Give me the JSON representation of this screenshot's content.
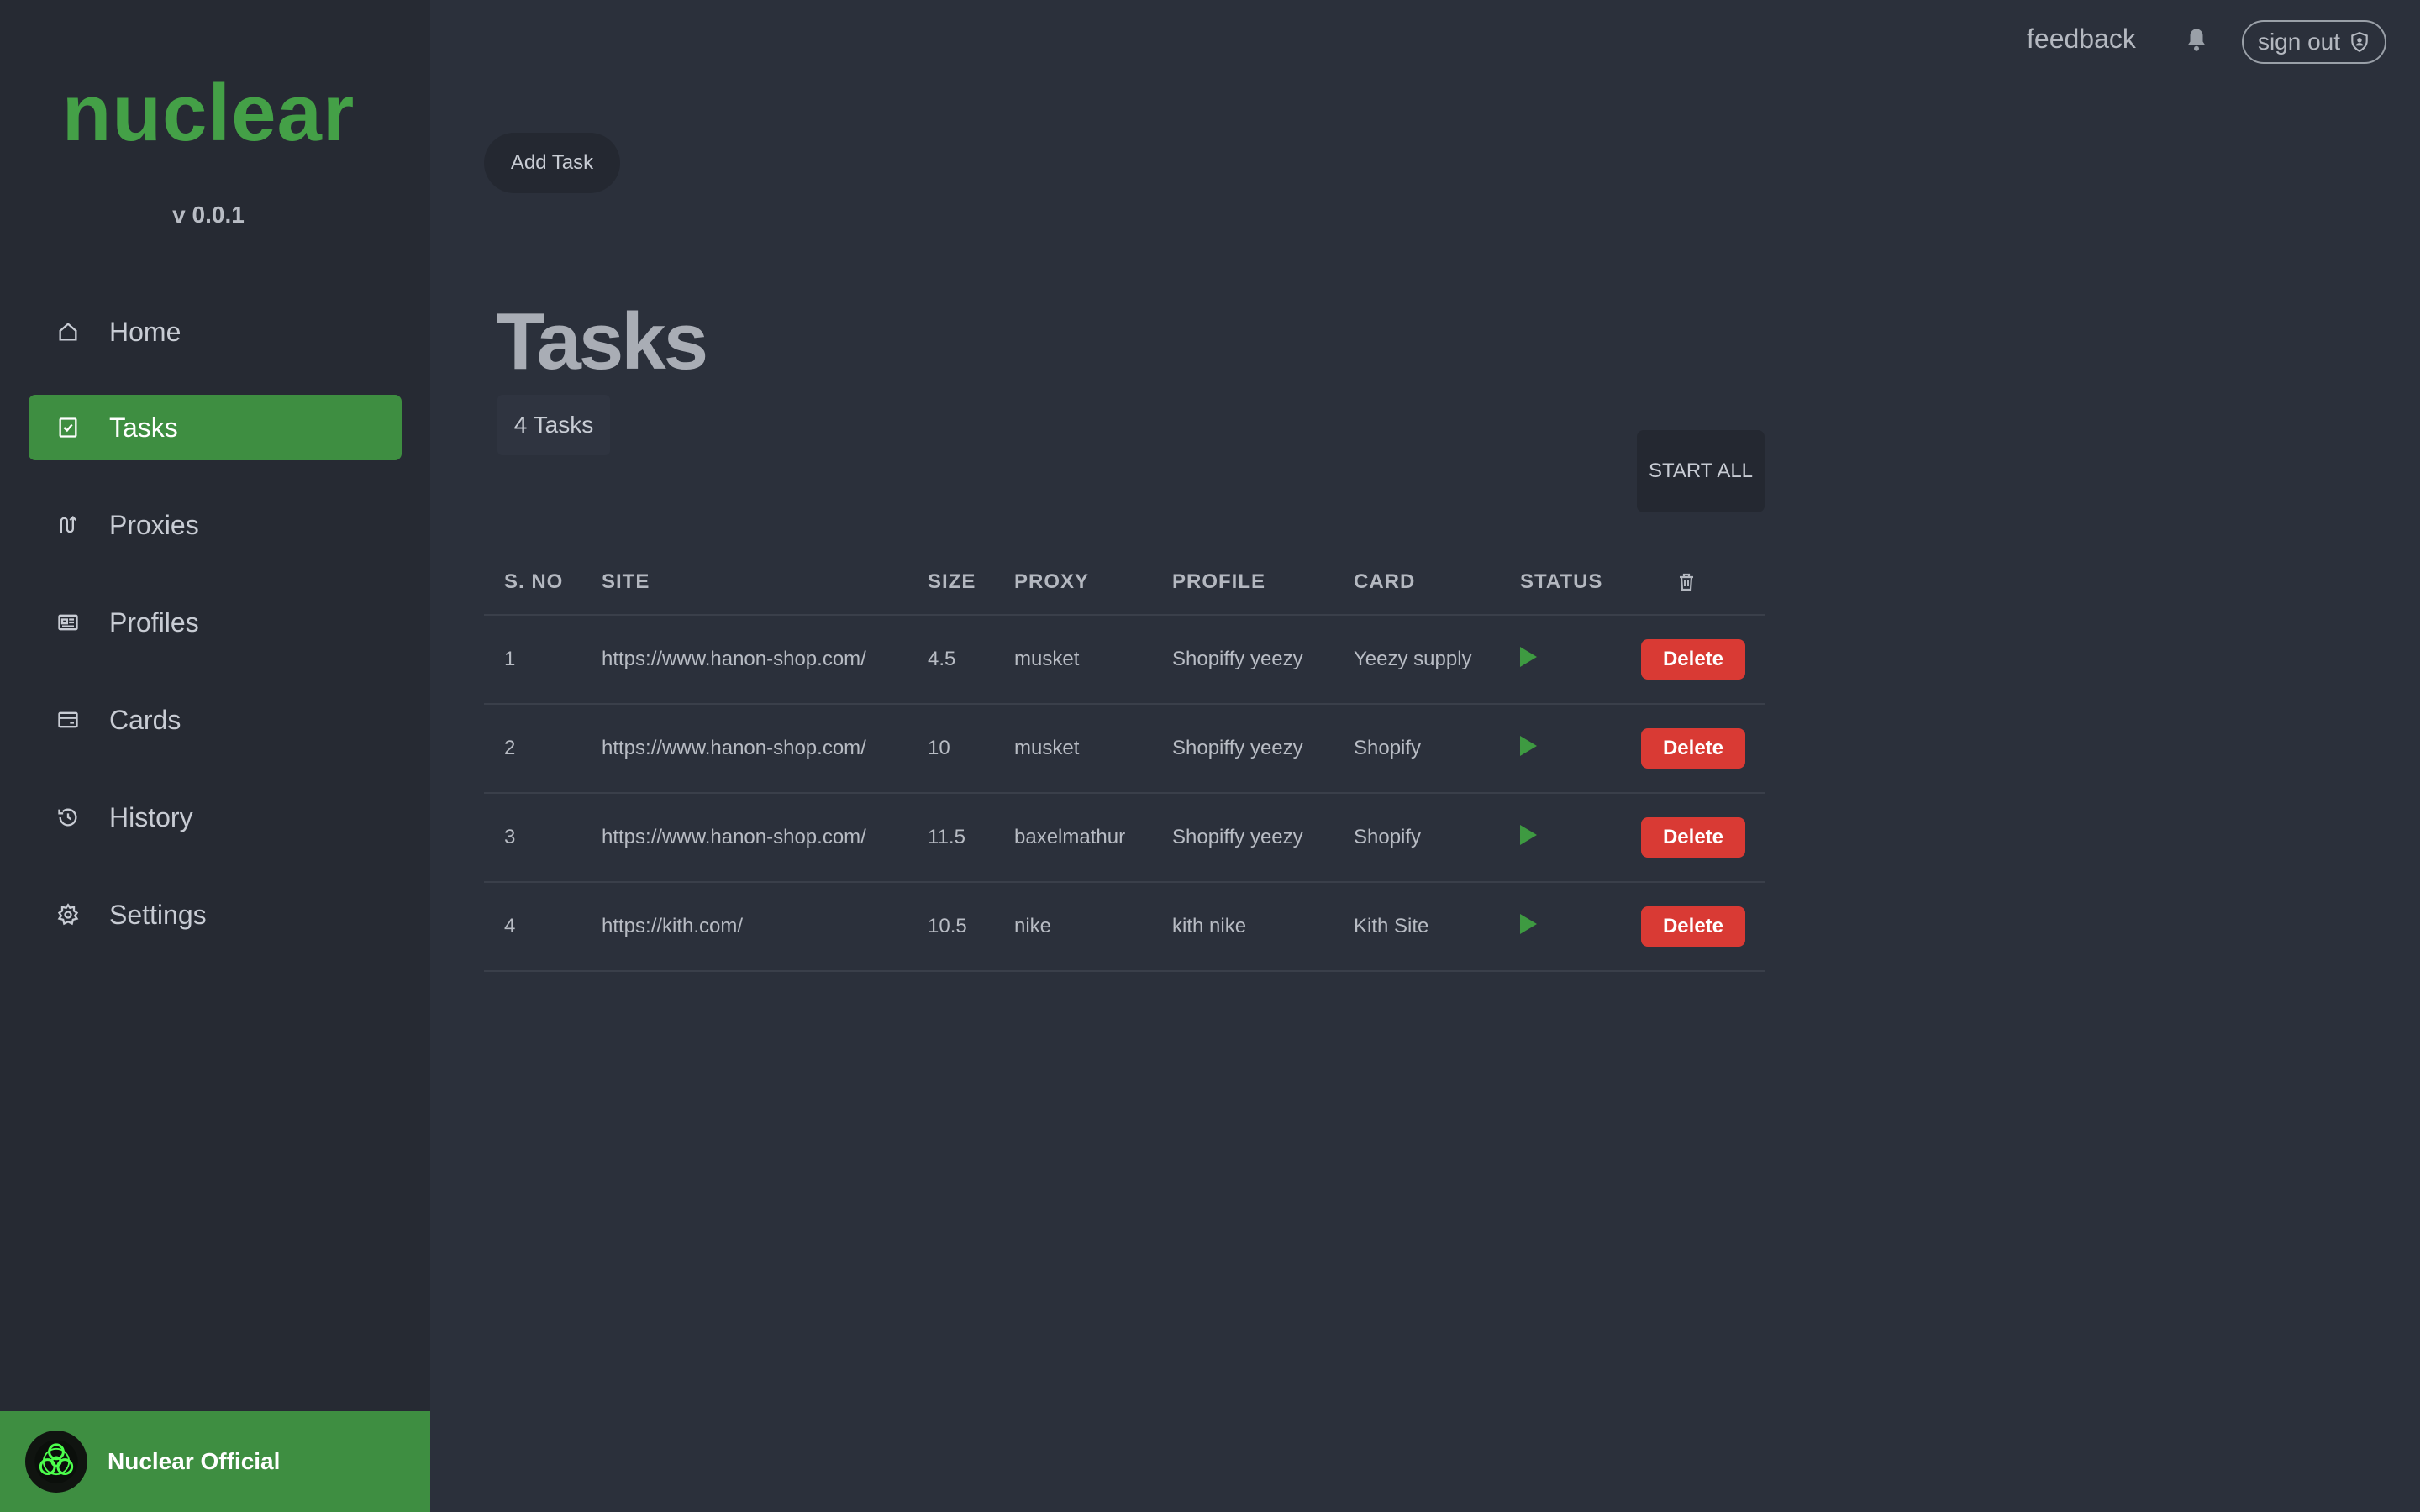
{
  "app": {
    "brand": "nuclear",
    "version": "v 0.0.1"
  },
  "sidebar": {
    "items": [
      {
        "label": "Home",
        "icon": "home-icon",
        "active": false
      },
      {
        "label": "Tasks",
        "icon": "check-square-icon",
        "active": true
      },
      {
        "label": "Proxies",
        "icon": "proxy-icon",
        "active": false
      },
      {
        "label": "Profiles",
        "icon": "id-card-icon",
        "active": false
      },
      {
        "label": "Cards",
        "icon": "credit-card-icon",
        "active": false
      },
      {
        "label": "History",
        "icon": "history-icon",
        "active": false
      },
      {
        "label": "Settings",
        "icon": "gear-icon",
        "active": false
      }
    ],
    "footer": {
      "name": "Nuclear Official",
      "avatar_icon": "biohazard-icon"
    }
  },
  "topbar": {
    "feedback": "feedback",
    "bell_icon": "bell-icon",
    "signout": "sign out",
    "signout_icon": "user-shield-icon"
  },
  "main": {
    "add_task": "Add Task",
    "title": "Tasks",
    "task_count": "4 Tasks",
    "start_all": "START ALL",
    "table": {
      "headers": [
        "S. NO",
        "SITE",
        "SIZE",
        "PROXY",
        "PROFILE",
        "CARD",
        "STATUS"
      ],
      "delete_header_icon": "trash-icon",
      "delete_label": "Delete",
      "rows": [
        {
          "sno": "1",
          "site": "https://www.hanon-shop.com/",
          "size": "4.5",
          "proxy": "musket",
          "profile": "Shopiffy yeezy",
          "card": "Yeezy supply"
        },
        {
          "sno": "2",
          "site": "https://www.hanon-shop.com/",
          "size": "10",
          "proxy": "musket",
          "profile": "Shopiffy yeezy",
          "card": "Shopify"
        },
        {
          "sno": "3",
          "site": "https://www.hanon-shop.com/",
          "size": "11.5",
          "proxy": "baxelmathur",
          "profile": "Shopiffy yeezy",
          "card": "Shopify"
        },
        {
          "sno": "4",
          "site": "https://kith.com/",
          "size": "10.5",
          "proxy": "nike",
          "profile": "kith nike",
          "card": "Kith Site"
        }
      ]
    }
  },
  "colors": {
    "accent": "#3e8e41",
    "brand": "#44a047",
    "delete": "#d93a34",
    "background": "#2b303b",
    "sidebar": "#262a33"
  }
}
